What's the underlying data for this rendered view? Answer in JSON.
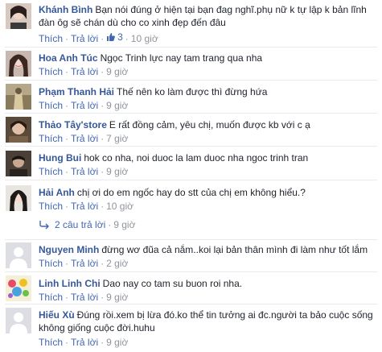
{
  "labels": {
    "like": "Thích",
    "reply": "Trả lời",
    "dot": "·"
  },
  "comments": [
    {
      "author": "Khánh Bình",
      "text": "Bạn nói đúng ở hiện tại bạn đag nghĩ.phụ nữ k tự lập k bản lĩnh đàn ôg sẽ chán dù cho co xinh đẹp đến đâu",
      "likes": "3",
      "time": "10 giờ"
    },
    {
      "author": "Hoa Anh Túc",
      "text": "Ngọc Trinh lực nay tam trang qua nha",
      "time": "9 giờ"
    },
    {
      "author": "Phạm Thanh Hải",
      "text": "Thế nên ko làm được thì đừng hứa",
      "time": "9 giờ"
    },
    {
      "author": "Thảo Tây'store",
      "text": "E rất đồng cảm, yêu chị, muốn được kb với c ạ",
      "time": "7 giờ"
    },
    {
      "author": "Hung Bui",
      "text": "hok co nha, noi duoc la lam duoc nha ngoc trinh tran",
      "time": "9 giờ"
    },
    {
      "author": "Hải Anh",
      "text": "chị ơi do em ngốc hay do stt của chị em không hiểu.?",
      "time": "10 giờ"
    },
    {
      "author": "Nguyen Minh",
      "text": "đừng wơ đũa cả nắm..koi lại bản thân mình đi làm như tốt lắm",
      "time": "2 giờ"
    },
    {
      "author": "Linh Linh Chi",
      "text": "Dao nay co tam su buon roi nha.",
      "time": "9 giờ"
    },
    {
      "author": "Hiếu Xù",
      "text": "Đúng rồi.xem bị lừa đó.ko thể tin tưởng ai đc.người ta bảo cuộc sống không giống cuộc đời.huhu",
      "time": "9 giờ"
    }
  ],
  "reply_thread": {
    "count_label": "2 câu trả lời",
    "time": "9 giờ"
  }
}
